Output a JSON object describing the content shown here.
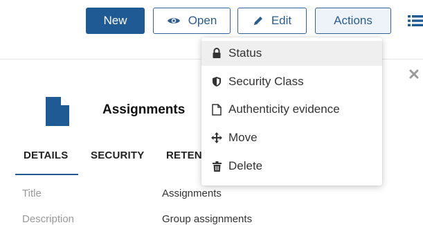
{
  "toolbar": {
    "new_label": "New",
    "open_label": "Open",
    "edit_label": "Edit",
    "actions_label": "Actions"
  },
  "record": {
    "title": "Assignments",
    "icon": "document-icon"
  },
  "tabs": [
    {
      "label": "DETAILS",
      "active": true
    },
    {
      "label": "SECURITY",
      "active": false
    },
    {
      "label": "RETEN",
      "active": false
    }
  ],
  "fields": [
    {
      "label": "Title",
      "value": "Assignments"
    },
    {
      "label": "Description",
      "value": "Group assignments"
    }
  ],
  "actions_menu": {
    "items": [
      {
        "label": "Status",
        "icon": "lock-icon",
        "highlighted": true
      },
      {
        "label": "Security Class",
        "icon": "shield-icon",
        "highlighted": false
      },
      {
        "label": "Authenticity evidence",
        "icon": "file-icon",
        "highlighted": false
      },
      {
        "label": "Move",
        "icon": "move-arrows-icon",
        "highlighted": false
      },
      {
        "label": "Delete",
        "icon": "trash-icon",
        "highlighted": false
      }
    ]
  },
  "colors": {
    "primary": "#1f5a94",
    "outline": "#2f6399",
    "menu_highlight": "#efefef"
  }
}
